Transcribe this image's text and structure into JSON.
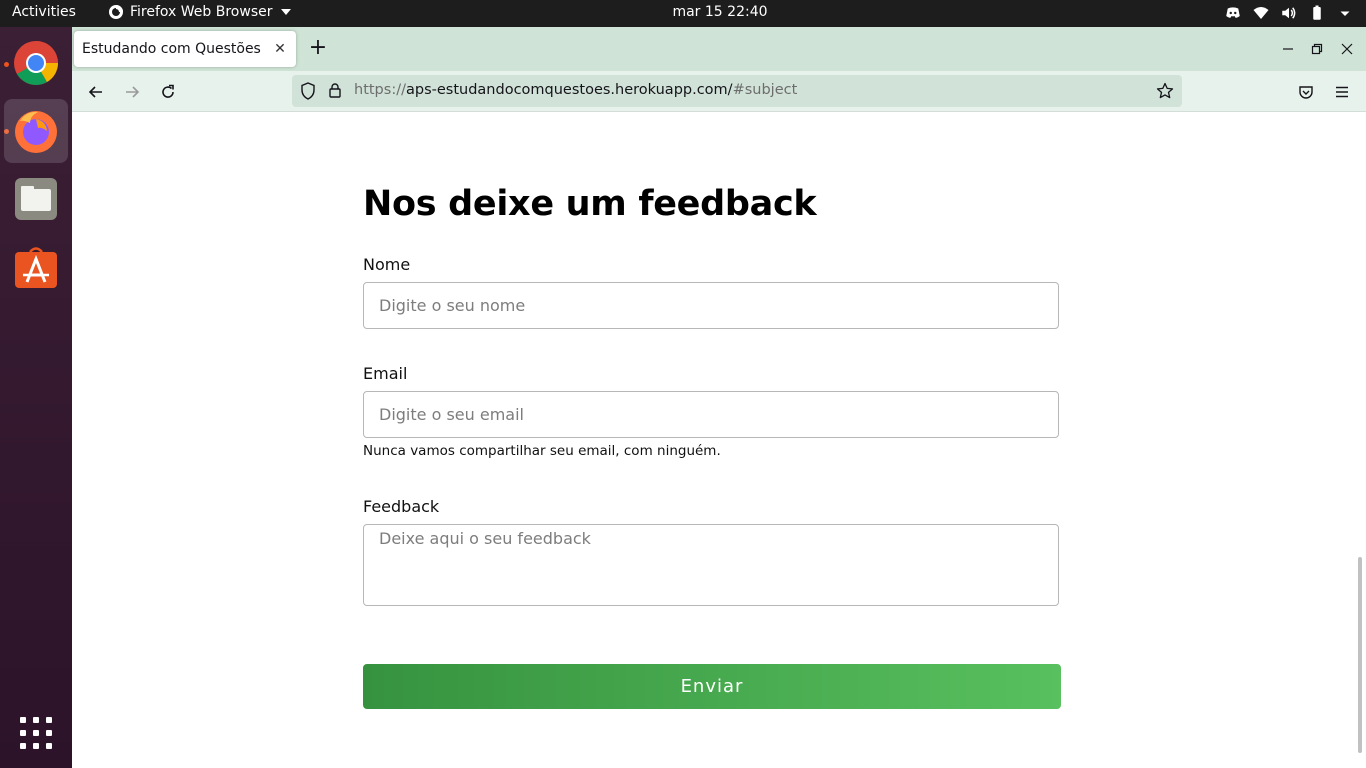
{
  "topbar": {
    "activities": "Activities",
    "app_name": "Firefox Web Browser",
    "clock": "mar 15  22:40",
    "tray_icons": [
      "discord-icon",
      "wifi-icon",
      "volume-icon",
      "battery-icon",
      "power-menu-icon"
    ]
  },
  "dock": {
    "apps": [
      "chrome",
      "firefox",
      "files",
      "software"
    ],
    "running": [
      "chrome",
      "firefox"
    ],
    "active": "firefox"
  },
  "browser": {
    "tab_title": "Estudando com Questões",
    "url_host": "https://aps-estudandocomquestoes.herokuapp.com/",
    "url_hash": "#subject",
    "url_scheme_shown": "https://",
    "url_domain": "aps-estudandocomquestoes.herokuapp.com/",
    "theme_color": "#cfe3d6"
  },
  "form": {
    "title": "Nos deixe um feedback",
    "name_label": "Nome",
    "name_placeholder": "Digite o seu nome",
    "email_label": "Email",
    "email_placeholder": "Digite o seu email",
    "email_help": "Nunca vamos compartilhar seu email, com ninguém.",
    "feedback_label": "Feedback",
    "feedback_placeholder": "Deixe aqui o seu feedback",
    "submit_label": "Enviar",
    "submit_color_start": "#36923f",
    "submit_color_end": "#58c05e"
  }
}
